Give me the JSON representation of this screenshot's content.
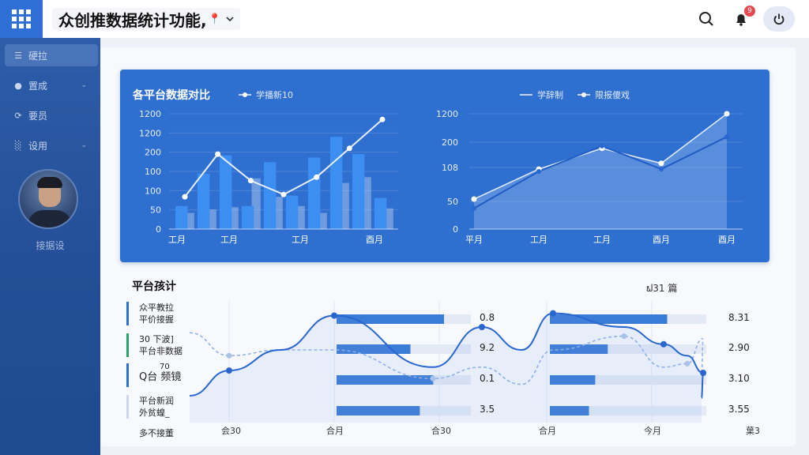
{
  "header": {
    "app_title": "众创推数据统计功能,",
    "title_suffix_icon": "pin-icon",
    "dropdown_icon": "chevron-down-icon",
    "search_icon": "search-icon",
    "bell_icon": "bell-icon",
    "notification_count": "9",
    "power_icon": "power-icon"
  },
  "sidebar": {
    "items": [
      {
        "icon": "menu-icon",
        "label": "硬拉"
      },
      {
        "icon": "dot-icon",
        "label": "置成"
      },
      {
        "icon": "refresh-icon",
        "label": "要员"
      },
      {
        "icon": "bars-icon",
        "label": "设用"
      }
    ],
    "user_name": "接据设"
  },
  "top_panel": {
    "title": "各平台数据对比",
    "legend_left": "学播新10",
    "legend_right": [
      "学辞制",
      "限报傻戏"
    ]
  },
  "chart_data": [
    {
      "type": "bar",
      "y_tick_labels": [
        "0",
        "50",
        "100",
        "100",
        "200",
        "1200",
        "1200"
      ],
      "x_tick_labels": [
        "工月",
        "工月",
        "工月",
        "酉月"
      ],
      "bars_primary": [
        20,
        48,
        64,
        20,
        58,
        29,
        62,
        80,
        65,
        27
      ],
      "bars_secondary": [
        14,
        17,
        19,
        44,
        28,
        20,
        14,
        40,
        45,
        18
      ],
      "line_series": {
        "name": "学播新10",
        "values": [
          28,
          65,
          42,
          30,
          45,
          70,
          95
        ]
      },
      "grid": true
    },
    {
      "type": "area",
      "y_tick_labels": [
        "0",
        "50",
        "108",
        "200",
        "1200"
      ],
      "x_tick_labels": [
        "平月",
        "工月",
        "工月",
        "酉月",
        "酉月"
      ],
      "series": [
        {
          "name": "学辞制",
          "values": [
            18,
            50,
            72,
            52,
            80
          ]
        },
        {
          "name": "限报傻戏",
          "values": [
            26,
            52,
            70,
            57,
            100
          ]
        }
      ],
      "grid": true
    }
  ],
  "bottom": {
    "title": "平台孩计",
    "summary": "ຟ31 篇",
    "rows": [
      {
        "label_line1": "众平教拉",
        "label_line2": "平价接握",
        "color": "#2f6fd0"
      },
      {
        "label_line1": "30 下波]",
        "label_line2": "平台非数据",
        "color": "#2aa36b"
      },
      {
        "label_line1": "Q台 频镜",
        "label_line2": "",
        "extra": "70",
        "color": "#2f6fd0"
      },
      {
        "label_line1": "平台新润",
        "label_line2": "外贫蝗_",
        "color": "#cfd8e8"
      }
    ],
    "footer_label": "多不接董",
    "values_left": [
      "0.8",
      "9.2",
      "0.1",
      "3.5"
    ],
    "values_right": [
      "8.31",
      "2.90",
      "3.10",
      "3.55"
    ],
    "progress_left": [
      0.8,
      0.55,
      0.72,
      0.62
    ],
    "progress_right": [
      0.75,
      0.37,
      0.29,
      0.25
    ],
    "x_tick_labels": [
      "会30",
      "合月",
      "合30",
      "合月",
      "今月",
      "葉3"
    ],
    "line_series": [
      {
        "name": "",
        "values": [
          20,
          42,
          60,
          90,
          45,
          80,
          60,
          92,
          80,
          65,
          55,
          40,
          18
        ]
      },
      {
        "name": "",
        "values": [
          75,
          55,
          60,
          60,
          35,
          45,
          30,
          60,
          72,
          45,
          48,
          70,
          40
        ]
      }
    ],
    "colors": {
      "accent": "#2f6fd0",
      "green": "#2aa36b",
      "track": "#e3eaf6"
    }
  }
}
